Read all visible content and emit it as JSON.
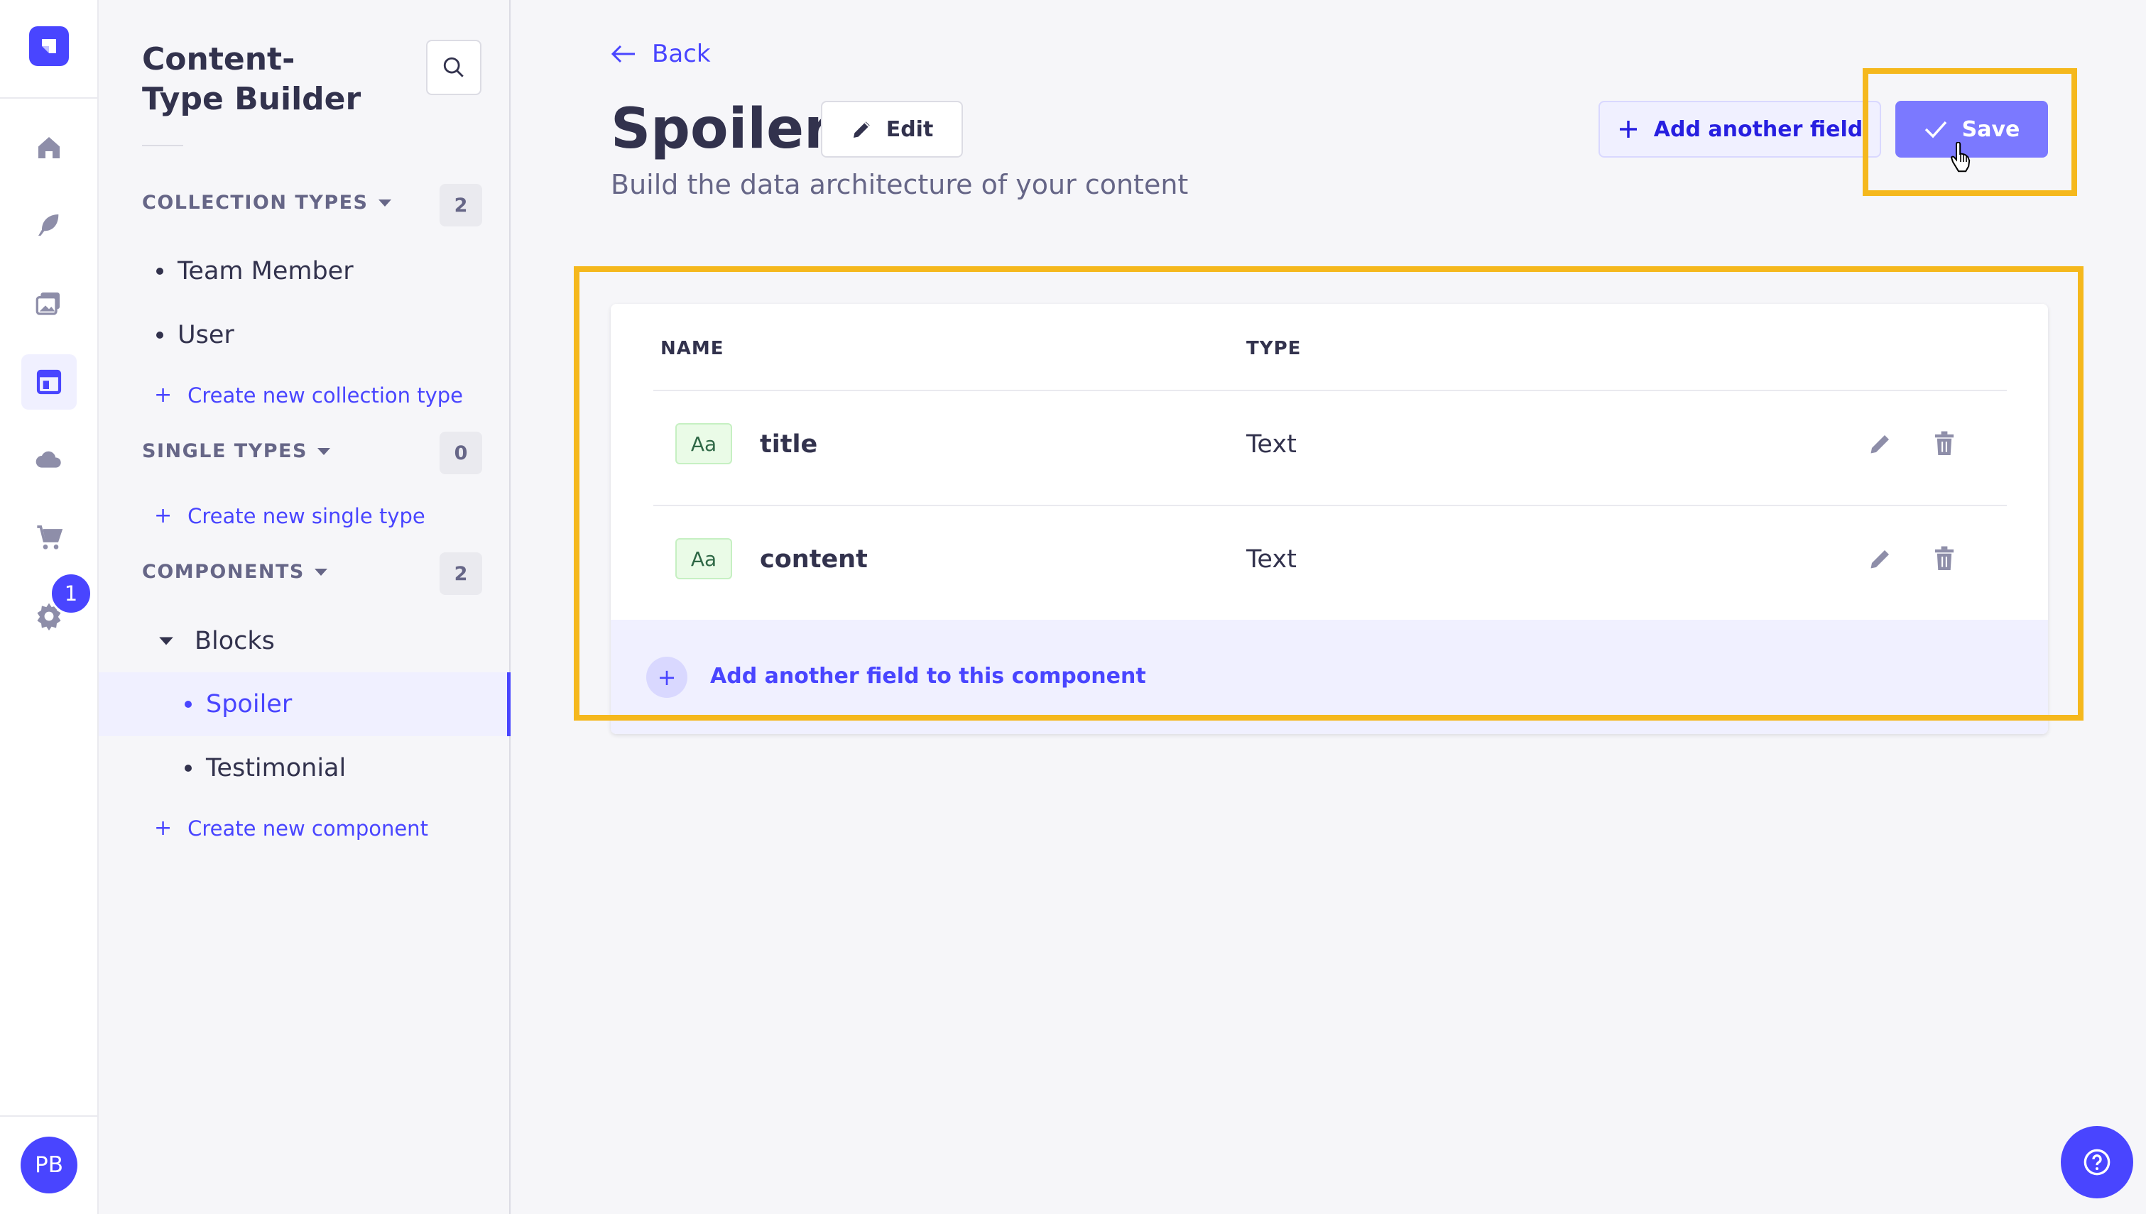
{
  "colors": {
    "primary": "#4945ff",
    "highlight": "#f5b81d",
    "text": "#32324d",
    "muted": "#666687"
  },
  "rail": {
    "items": [
      "home-icon",
      "feather-icon",
      "media-library-icon",
      "content-type-builder-icon",
      "cloud-icon",
      "cart-icon",
      "settings-icon"
    ],
    "settings_badge": "1",
    "avatar_initials": "PB"
  },
  "subnav": {
    "title": "Content-Type Builder",
    "collection_types": {
      "label": "COLLECTION TYPES",
      "count": "2",
      "items": [
        "Team Member",
        "User"
      ],
      "create_label": "Create new collection type"
    },
    "single_types": {
      "label": "SINGLE TYPES",
      "count": "0",
      "create_label": "Create new single type"
    },
    "components": {
      "label": "COMPONENTS",
      "count": "2",
      "category": "Blocks",
      "items": [
        "Spoiler",
        "Testimonial"
      ],
      "active_item": "Spoiler",
      "create_label": "Create new component"
    }
  },
  "header": {
    "back_label": "Back",
    "title": "Spoiler",
    "edit_label": "Edit",
    "subtitle": "Build the data architecture of your content",
    "add_field_label": "Add another field",
    "save_label": "Save"
  },
  "table": {
    "columns": [
      "NAME",
      "TYPE"
    ],
    "rows": [
      {
        "icon_text": "Aa",
        "name": "title",
        "type": "Text"
      },
      {
        "icon_text": "Aa",
        "name": "content",
        "type": "Text"
      }
    ],
    "add_label": "Add another field to this component"
  }
}
